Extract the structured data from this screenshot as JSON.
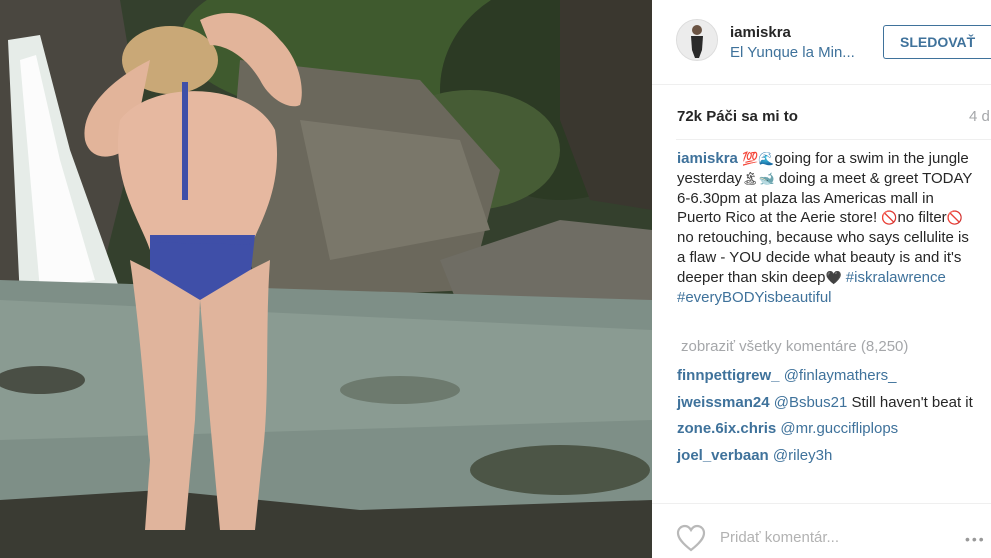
{
  "post": {
    "username": "iamiskra",
    "location": "El Yunque la Min...",
    "follow_label": "SLEDOVAŤ",
    "likes": "72k Páči sa mi to",
    "time": "4 d",
    "caption": {
      "username": "iamiskra",
      "part1": "going for a swim in the jungle yesterday",
      "part2": " doing a meet & greet TODAY 6-6.30pm at plaza las Americas mall in Puerto Rico at the Aerie store! ",
      "part3": "no filter",
      "part4": " no retouching, because who says cellulite is a flaw - YOU decide what beauty is and it's deeper than skin deep",
      "hashtag1": " #iskralawrence",
      "hashtag2": "#everyBODYisbeautiful"
    },
    "view_all_comments": "zobraziť všetky komentáre (8,250)",
    "comments": [
      {
        "user": "finnpettigrew_",
        "mention": "@finlaymathers_",
        "text": ""
      },
      {
        "user": "jweissman24",
        "mention": "@Bsbus21",
        "text": " Still haven't beat it"
      },
      {
        "user": "zone.6ix.chris",
        "mention": "@mr.guccifliplops",
        "text": ""
      },
      {
        "user": "joel_verbaan",
        "mention": "@riley3h",
        "text": ""
      }
    ],
    "add_comment_placeholder": "Pridať komentár...",
    "more_label": "•••"
  },
  "icons": {
    "emoji_1": "hundred-points-icon",
    "emoji_2": "wave-icon",
    "emoji_3": "island-icon",
    "emoji_4": "whale-icon",
    "emoji_5": "no-entry-icon",
    "emoji_6": "no-entry-icon",
    "emoji_7": "black-heart-icon",
    "heart": "heart-outline-icon"
  },
  "colors": {
    "link": "#3f729b",
    "text": "#262626",
    "muted": "#a5a7aa"
  }
}
